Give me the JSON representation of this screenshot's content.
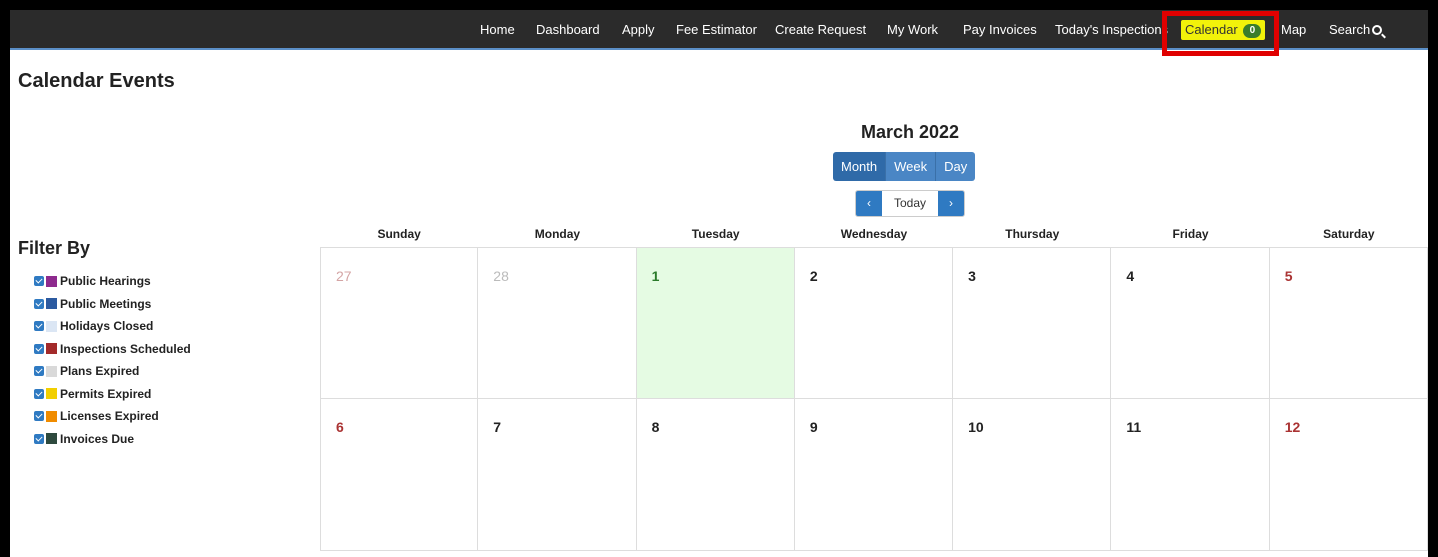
{
  "nav": {
    "items": [
      "Home",
      "Dashboard",
      "Apply",
      "Fee Estimator",
      "Create Request",
      "My Work",
      "Pay Invoices",
      "Today's Inspections"
    ],
    "calendar_label": "Calendar",
    "calendar_count": "0",
    "map_label": "Map",
    "search_label": "Search",
    "highlight_color": "#e00000"
  },
  "page": {
    "title": "Calendar Events"
  },
  "calendar": {
    "month_title": "March 2022",
    "views": [
      "Month",
      "Week",
      "Day"
    ],
    "active_view": "Month",
    "prev_icon": "‹",
    "today_label": "Today",
    "next_icon": "›",
    "days_of_week": [
      "Sunday",
      "Monday",
      "Tuesday",
      "Wednesday",
      "Thursday",
      "Friday",
      "Saturday"
    ],
    "weeks": [
      [
        "27",
        "28",
        "1",
        "2",
        "3",
        "4",
        "5"
      ],
      [
        "6",
        "7",
        "8",
        "9",
        "10",
        "11",
        "12"
      ]
    ],
    "today": "1",
    "today_color": "#e5fbe3"
  },
  "filter": {
    "title": "Filter By",
    "items": [
      {
        "label": "Public Hearings",
        "color": "#8e2a8e",
        "checked": true
      },
      {
        "label": "Public Meetings",
        "color": "#2c5aa0",
        "checked": true
      },
      {
        "label": "Holidays Closed",
        "color": "#dbe6f4",
        "checked": true
      },
      {
        "label": "Inspections Scheduled",
        "color": "#a32a2a",
        "checked": true
      },
      {
        "label": "Plans Expired",
        "color": "#d9d9d9",
        "checked": true
      },
      {
        "label": "Permits Expired",
        "color": "#f2cf00",
        "checked": true
      },
      {
        "label": "Licenses Expired",
        "color": "#f08c00",
        "checked": true
      },
      {
        "label": "Invoices Due",
        "color": "#2e4a3e",
        "checked": true
      }
    ]
  }
}
